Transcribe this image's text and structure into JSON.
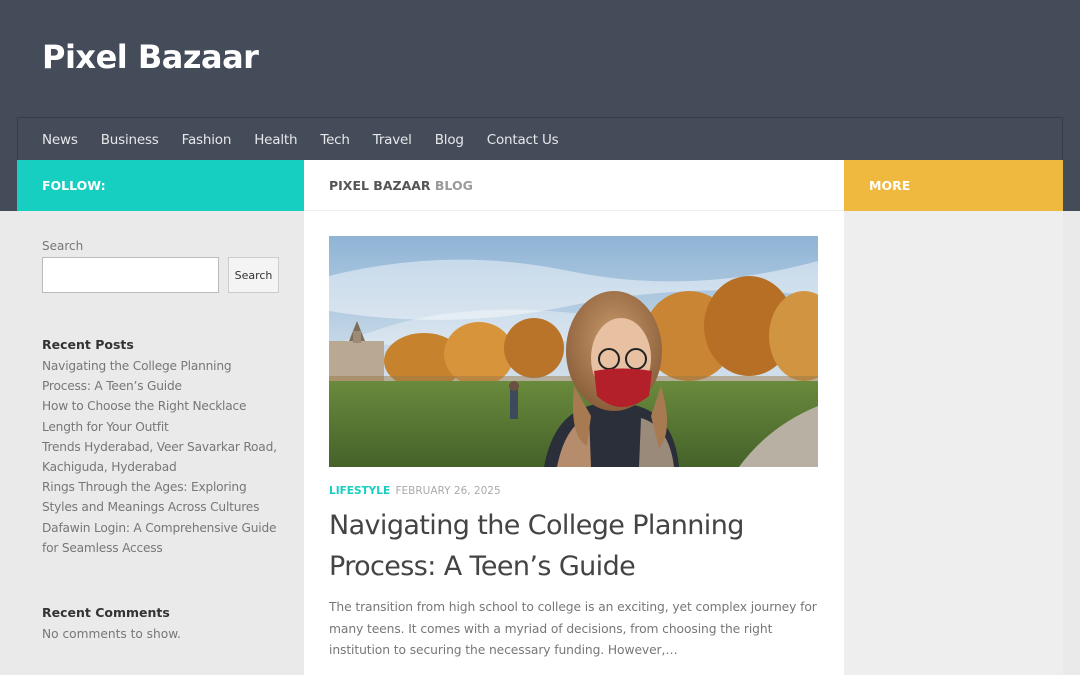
{
  "site": {
    "title": "Pixel Bazaar"
  },
  "nav": {
    "items": [
      {
        "label": "News"
      },
      {
        "label": "Business"
      },
      {
        "label": "Fashion"
      },
      {
        "label": "Health"
      },
      {
        "label": "Tech"
      },
      {
        "label": "Travel"
      },
      {
        "label": "Blog"
      },
      {
        "label": "Contact Us"
      }
    ]
  },
  "bars": {
    "follow": "FOLLOW:",
    "more": "MORE",
    "main_heading": "PIXEL BAZAAR",
    "main_heading_suffix": "BLOG"
  },
  "sidebar": {
    "search_label": "Search",
    "search_value": "",
    "search_button": "Search",
    "recent_posts_title": "Recent Posts",
    "recent_posts": [
      "Navigating the College Planning Process: A Teen’s Guide",
      "How to Choose the Right Necklace Length for Your Outfit",
      "Trends Hyderabad, Veer Savarkar Road, Kachiguda, Hyderabad",
      "Rings Through the Ages: Exploring Styles and Meanings Across Cultures",
      "Dafawin Login: A Comprehensive Guide for Seamless Access"
    ],
    "recent_comments_title": "Recent Comments",
    "no_comments": "No comments to show."
  },
  "article": {
    "category": "LIFESTYLE",
    "date": "FEBRUARY 26, 2025",
    "title": "Navigating the College Planning Process: A Teen’s Guide",
    "excerpt": "The transition from high school to college is an exciting, yet complex journey for many teens. It comes with a myriad of decisions, from choosing the right institution to securing the necessary funding. However,…"
  },
  "colors": {
    "header": "#444c59",
    "follow": "#16cfc1",
    "more": "#efb93f",
    "accent": "#16cfc1"
  }
}
